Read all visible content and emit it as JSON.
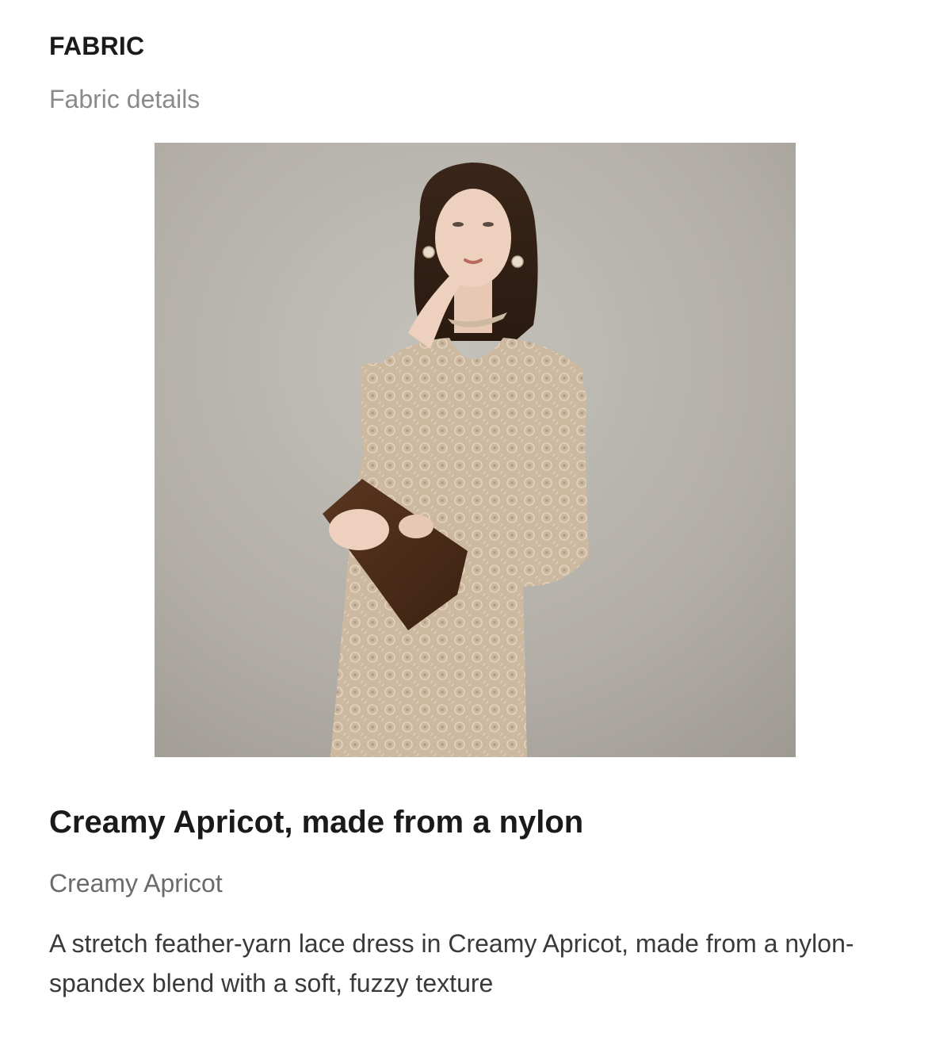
{
  "section": {
    "label": "FABRIC",
    "subtitle": "Fabric details"
  },
  "product": {
    "title": "Creamy Apricot, made from a nylon",
    "color_name": "Creamy Apricot",
    "description": "A stretch feather-yarn lace dress in Creamy Apricot, made from a nylon-spandex blend with a soft, fuzzy texture"
  },
  "colors": {
    "background": "#ffffff",
    "heading": "#1a1a1a",
    "muted": "#8a8a8a",
    "body_text": "#3a3a3a",
    "dress": "#cdb8a0",
    "clutch": "#4a2c18",
    "backdrop": "#b6b2ac"
  }
}
